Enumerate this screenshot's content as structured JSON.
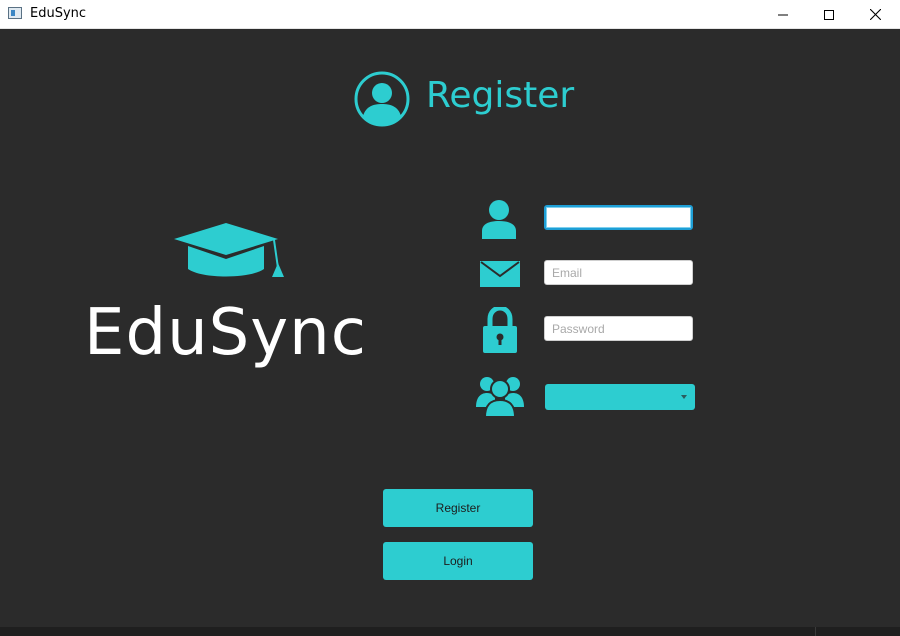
{
  "window": {
    "title": "EduSync",
    "controls": [
      "minimize-icon",
      "maximize-icon",
      "close-icon"
    ]
  },
  "header": {
    "icon": "user-circle-icon",
    "title": "Register"
  },
  "brand": {
    "icon": "graduation-cap-icon",
    "name": "EduSync"
  },
  "form": {
    "username": {
      "icon": "user-icon",
      "value": "",
      "placeholder": ""
    },
    "email": {
      "icon": "envelope-icon",
      "value": "",
      "placeholder": "Email"
    },
    "password": {
      "icon": "lock-icon",
      "value": "",
      "placeholder": "Password"
    },
    "role": {
      "icon": "users-group-icon",
      "selected": ""
    }
  },
  "buttons": {
    "register": "Register",
    "login": "Login"
  },
  "colors": {
    "accent": "#2dcdd0",
    "background": "#2b2b2b",
    "text_light": "#ffffff",
    "focus_border": "#1e9fd6"
  }
}
